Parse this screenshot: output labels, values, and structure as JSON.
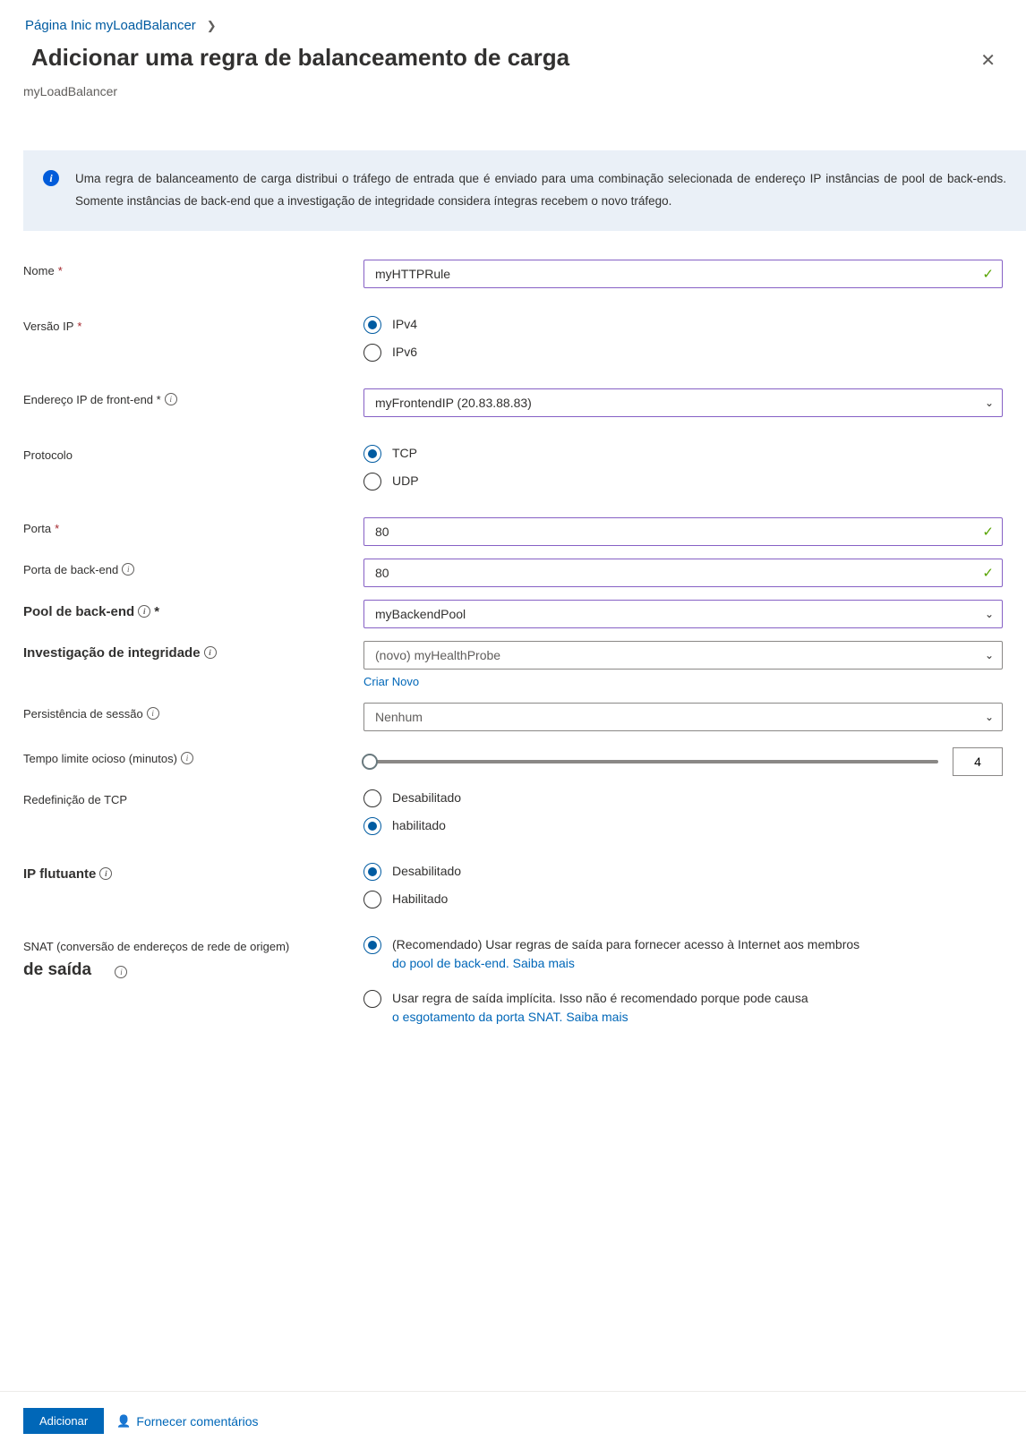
{
  "breadcrumb": {
    "item1": "Página Inic",
    "item2": "myLoadBalancer"
  },
  "header": {
    "title": "Adicionar uma regra de balanceamento de carga",
    "subtitle": "myLoadBalancer"
  },
  "info": {
    "text": "Uma regra de balanceamento de carga distribui o tráfego de entrada que é enviado para uma combinação selecionada de endereço IP instâncias de pool de back-ends. Somente instâncias de back-end que a investigação de integridade considera íntegras recebem o novo tráfego."
  },
  "labels": {
    "name": "Nome",
    "ipversion": "Versão IP",
    "frontend": "Endereço IP de front-end *",
    "protocol": "Protocolo",
    "port": "Porta",
    "backend_port": "Porta de back-end",
    "backend_pool": "Pool de back-end",
    "backend_pool_suffix": "*",
    "health_probe": "Investigação de integridade",
    "session": "Persistência de sessão",
    "idle": "Tempo limite ocioso (minutos)",
    "tcp_reset": "Redefinição de TCP",
    "floating": "IP flutuante",
    "snat_line1": "SNAT (conversão de endereços de rede de origem)",
    "snat_line2": "de saída"
  },
  "values": {
    "name": "myHTTPRule",
    "frontend": "myFrontendIP (20.83.88.83)",
    "port": "80",
    "backend_port": "80",
    "backend_pool": "myBackendPool",
    "health_probe": "(novo) myHealthProbe",
    "session": "Nenhum",
    "idle": "4"
  },
  "radios": {
    "ipv4": "IPv4",
    "ipv6": "IPv6",
    "tcp": "TCP",
    "udp": "UDP",
    "disabled": "Desabilitado",
    "enabled_lc": "habilitado",
    "enabled": "Habilitado",
    "snat_recommended_pre": "(Recomendado) Usar regras de saída para fornecer acesso à Internet aos membros ",
    "snat_recommended_link_pre": "do pool de back-end. ",
    "snat_implicit_pre": "Usar regra de saída implícita. Isso não é recomendado porque pode causa",
    "snat_implicit_pre2": "o esgotamento da porta SNAT. ",
    "learn_more": "Saiba mais"
  },
  "links": {
    "create_new": "Criar Novo"
  },
  "footer": {
    "add": "Adicionar",
    "feedback": "Fornecer comentários"
  }
}
